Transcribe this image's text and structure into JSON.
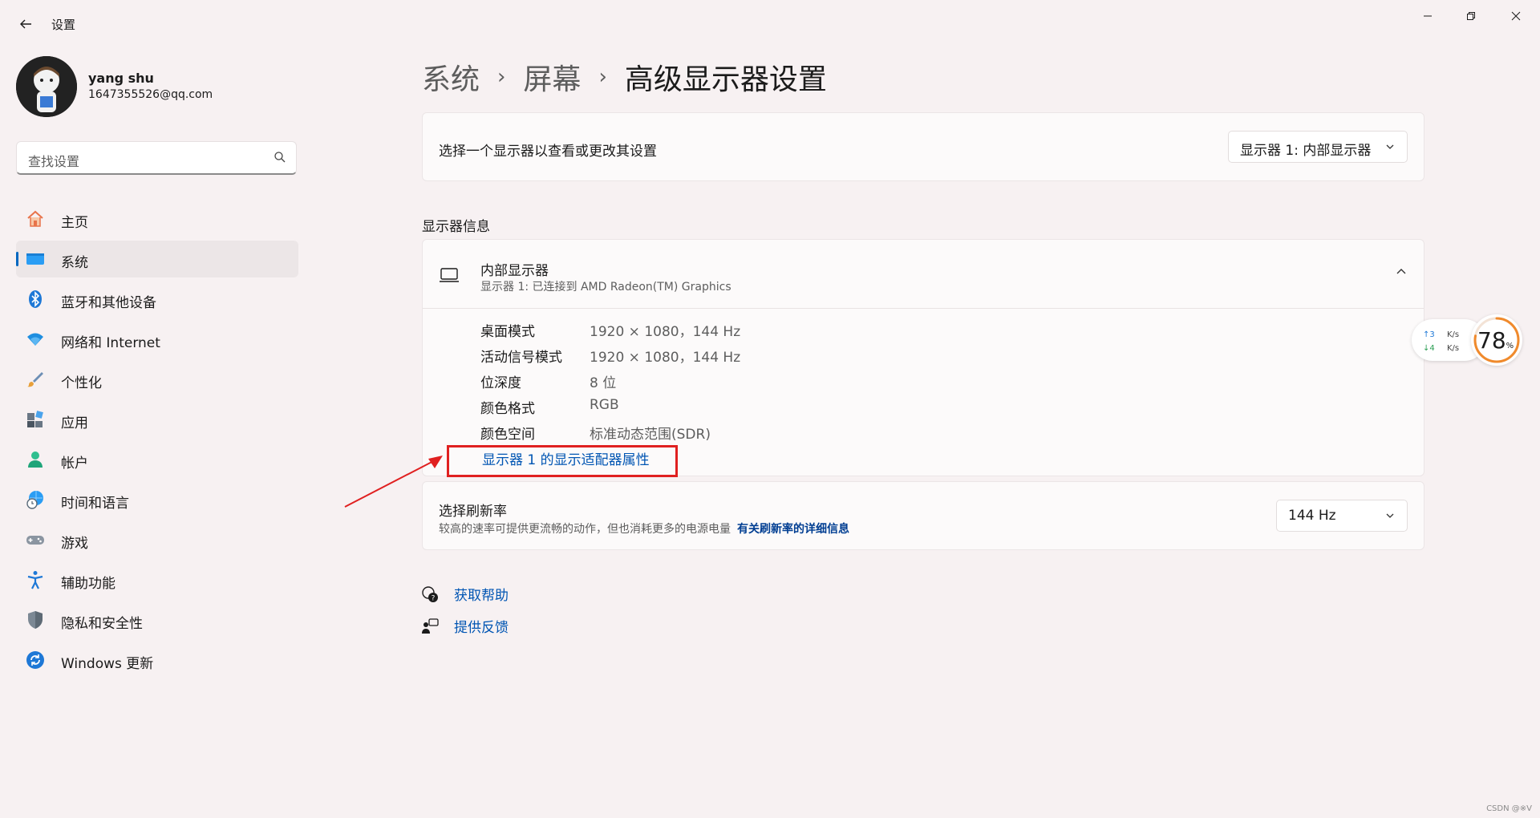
{
  "window": {
    "title": "设置",
    "controls": [
      "minimize-icon",
      "restore-icon",
      "close-icon"
    ]
  },
  "profile": {
    "name": "yang shu",
    "email": "1647355526@qq.com"
  },
  "search": {
    "placeholder": "查找设置"
  },
  "sidebar": {
    "items": [
      {
        "label": "主页",
        "icon": "home-icon"
      },
      {
        "label": "系统",
        "icon": "system-icon",
        "active": true
      },
      {
        "label": "蓝牙和其他设备",
        "icon": "bluetooth-icon"
      },
      {
        "label": "网络和 Internet",
        "icon": "wifi-icon"
      },
      {
        "label": "个性化",
        "icon": "brush-icon"
      },
      {
        "label": "应用",
        "icon": "apps-icon"
      },
      {
        "label": "帐户",
        "icon": "account-icon"
      },
      {
        "label": "时间和语言",
        "icon": "globe-clock-icon"
      },
      {
        "label": "游戏",
        "icon": "gamepad-icon"
      },
      {
        "label": "辅助功能",
        "icon": "accessibility-icon"
      },
      {
        "label": "隐私和安全性",
        "icon": "shield-icon"
      },
      {
        "label": "Windows 更新",
        "icon": "update-icon"
      }
    ]
  },
  "breadcrumb": {
    "items": [
      "系统",
      "屏幕"
    ],
    "separator": "›",
    "current": "高级显示器设置"
  },
  "select_display": {
    "label": "选择一个显示器以查看或更改其设置",
    "value": "显示器 1: 内部显示器"
  },
  "display_info": {
    "section_title": "显示器信息",
    "name": "内部显示器",
    "subtitle": "显示器 1: 已连接到 AMD Radeon(TM) Graphics",
    "rows": [
      {
        "key": "桌面模式",
        "value": "1920 × 1080，144 Hz"
      },
      {
        "key": "活动信号模式",
        "value": "1920 × 1080，144 Hz"
      },
      {
        "key": "位深度",
        "value": "8 位"
      },
      {
        "key": "颜色格式",
        "value": "RGB"
      },
      {
        "key": "颜色空间",
        "value": "标准动态范围(SDR)"
      }
    ],
    "adapter_link": "显示器 1 的显示适配器属性"
  },
  "refresh_rate": {
    "title": "选择刷新率",
    "description": "较高的速率可提供更流畅的动作，但也消耗更多的电源电量",
    "link": "有关刷新率的详细信息",
    "value": "144 Hz"
  },
  "help": {
    "get_help": "获取帮助",
    "feedback": "提供反馈"
  },
  "net_monitor": {
    "up": "↑3",
    "down": "↓4",
    "unit": "K/s",
    "percent": "78",
    "percent_sign": "%"
  },
  "watermark": "CSDN @※V",
  "colors": {
    "accent": "#0067c0",
    "link": "#0055b3",
    "highlight": "#e02020",
    "background": "#f7f1f2"
  }
}
